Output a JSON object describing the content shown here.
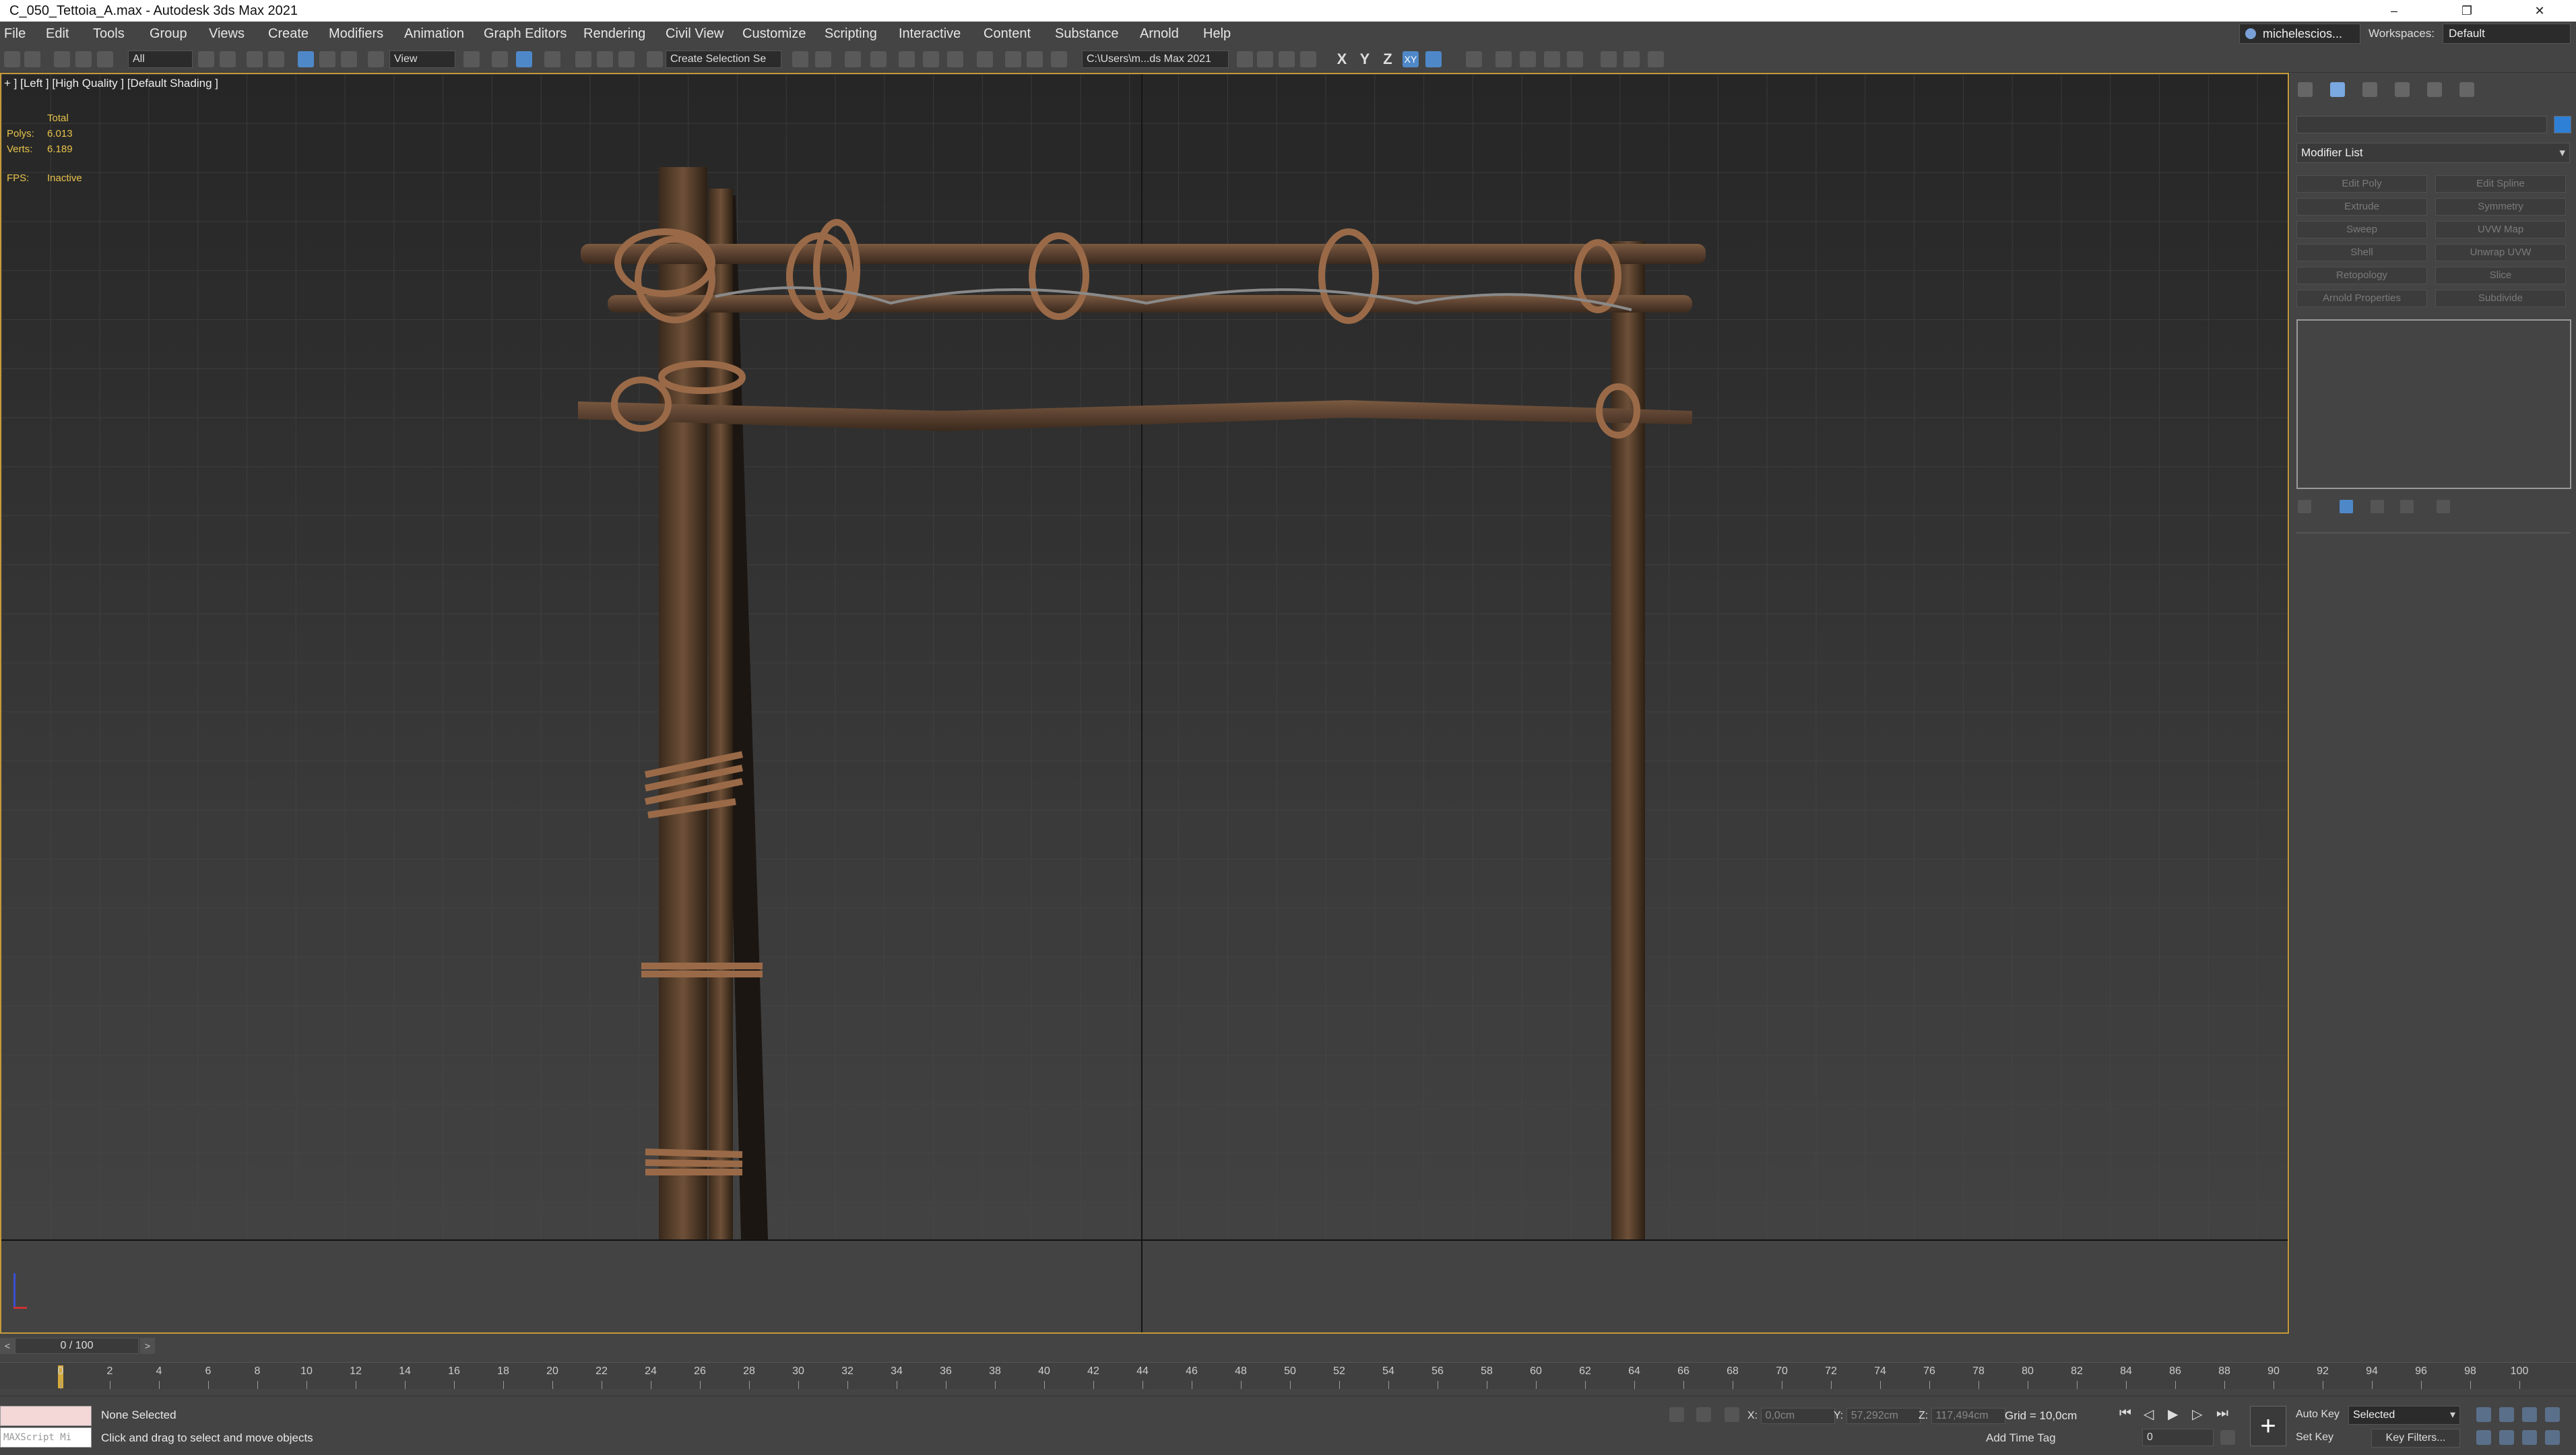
{
  "window": {
    "title": "C_050_Tettoia_A.max - Autodesk 3ds Max 2021",
    "controls": [
      "–",
      "❐",
      "✕"
    ]
  },
  "menu": [
    "File",
    "Edit",
    "Tools",
    "Group",
    "Views",
    "Create",
    "Modifiers",
    "Animation",
    "Graph Editors",
    "Rendering",
    "Civil View",
    "Customize",
    "Scripting",
    "Interactive",
    "Content",
    "Substance",
    "Arnold",
    "Help"
  ],
  "user": {
    "name": "michelescios...",
    "workspaces_label": "Workspaces:",
    "workspace": "Default"
  },
  "toolbar": {
    "filter": "All",
    "coord_system": "View",
    "selection_set": "Create Selection Se",
    "project_path": "C:\\Users\\m...ds Max 2021",
    "axes": [
      "X",
      "Y",
      "Z"
    ],
    "plane": "XY"
  },
  "viewport": {
    "label": "+ ] [Left ] [High Quality ] [Default Shading ]",
    "stats": {
      "header": "Total",
      "polys_label": "Polys:",
      "polys": "6.013",
      "verts_label": "Verts:",
      "verts": "6.189",
      "fps_label": "FPS:",
      "fps": "Inactive"
    }
  },
  "command_panel": {
    "modifier_list": "Modifier List",
    "modifier_buttons": [
      "Edit Poly",
      "Edit Spline",
      "Extrude",
      "Symmetry",
      "Sweep",
      "UVW Map",
      "Shell",
      "Unwrap UVW",
      "Retopology",
      "Slice",
      "Arnold Properties",
      "Subdivide"
    ]
  },
  "timeline": {
    "slider": "0 / 100",
    "prev": "<",
    "next": ">",
    "ticks": [
      0,
      2,
      4,
      6,
      8,
      10,
      12,
      14,
      16,
      18,
      20,
      22,
      24,
      26,
      28,
      30,
      32,
      34,
      36,
      38,
      40,
      42,
      44,
      46,
      48,
      50,
      52,
      54,
      56,
      58,
      60,
      62,
      64,
      66,
      68,
      70,
      72,
      74,
      76,
      78,
      80,
      82,
      84,
      86,
      88,
      90,
      92,
      94,
      96,
      98,
      100
    ]
  },
  "status": {
    "maxscript": "MAXScript Mi",
    "selection": "None Selected",
    "prompt": "Click and drag to select and move objects",
    "x_label": "X:",
    "x": "0,0cm",
    "y_label": "Y:",
    "y": "57,292cm",
    "z_label": "Z:",
    "z": "117,494cm",
    "grid": "Grid = 10,0cm",
    "add_time_tag": "Add Time Tag",
    "auto_key": "Auto Key",
    "set_key": "Set Key",
    "key_mode": "Selected",
    "key_filters": "Key Filters...",
    "frame": "0"
  }
}
